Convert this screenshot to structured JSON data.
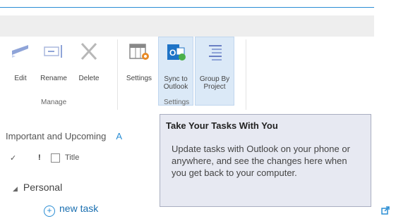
{
  "ribbon": {
    "manage_buttons": [
      {
        "label": "Edit",
        "icon": "edit-icon"
      },
      {
        "label": "Rename",
        "icon": "rename-icon"
      },
      {
        "label": "Delete",
        "icon": "delete-icon"
      }
    ],
    "manage_group_label": "Manage",
    "settings_buttons": [
      {
        "label": "Settings",
        "icon": "settings-icon"
      },
      {
        "label_line1": "Sync to",
        "label_line2": "Outlook",
        "icon": "outlook-sync-icon"
      },
      {
        "label_line1": "Group By",
        "label_line2": "Project",
        "icon": "group-by-icon"
      }
    ],
    "settings_group_label": "Settings"
  },
  "views": {
    "important_label": "Important and Upcoming",
    "second_label": "A"
  },
  "columns": {
    "check": "✓",
    "priority": "!",
    "title": "Title"
  },
  "list": {
    "group_name": "Personal",
    "new_task_label": "new task"
  },
  "tooltip": {
    "title": "Take Your Tasks With You",
    "body": "Update tasks with Outlook on your phone or anywhere, and see the changes here when you get back to your computer."
  },
  "colors": {
    "accent": "#2a8dd4",
    "tooltip_bg": "#e7e9f2",
    "highlight_bg": "#dbe9f7"
  }
}
